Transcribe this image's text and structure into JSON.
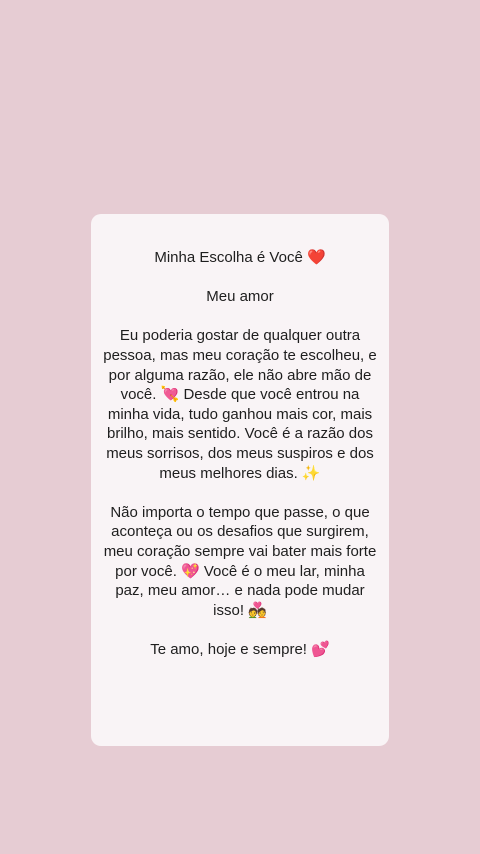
{
  "story": {
    "title": "Minha Escolha é Você ❤️",
    "greeting": "Meu amor",
    "paragraph1": "Eu poderia gostar de qualquer outra pessoa, mas meu coração te escolheu, e por alguma razão, ele não abre mão de você. 💘 Desde que você entrou na minha vida, tudo ganhou mais cor, mais brilho, mais sentido. Você é a razão dos meus sorrisos, dos meus suspiros e dos meus melhores dias. ✨",
    "paragraph2": "Não importa o tempo que passe, o que aconteça ou os desafios que surgirem, meu coração sempre vai bater mais forte por você. 💖 Você é o meu lar, minha paz, meu amor… e nada pode mudar isso! 💑",
    "closing": "Te amo, hoje e sempre! 💕"
  },
  "colors": {
    "background": "#e6ccd3",
    "card": "#faf6f7",
    "text": "#1e1e1e"
  }
}
